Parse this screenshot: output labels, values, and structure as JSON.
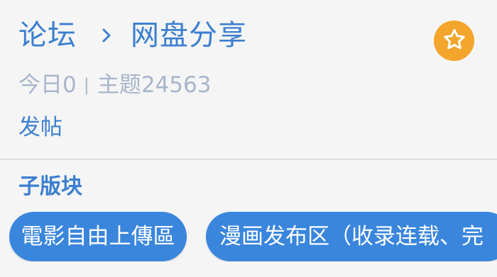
{
  "header": {
    "breadcrumb_root": "论坛",
    "breadcrumb_current": "网盘分享",
    "favorite_icon": "star-icon",
    "colors": {
      "accent": "#3b7fcf",
      "favorite": "#f3a52c",
      "muted": "#a7b5cb"
    }
  },
  "stats": {
    "today": "今日0",
    "separator": "|",
    "topics": "主题24563"
  },
  "actions": {
    "post_label": "发帖"
  },
  "subforums": {
    "title": "子版块",
    "items": [
      {
        "label": "電影自由上傳區"
      },
      {
        "label": "漫画发布区（收录连载、完"
      }
    ],
    "chip_color": "#3a86dc"
  }
}
